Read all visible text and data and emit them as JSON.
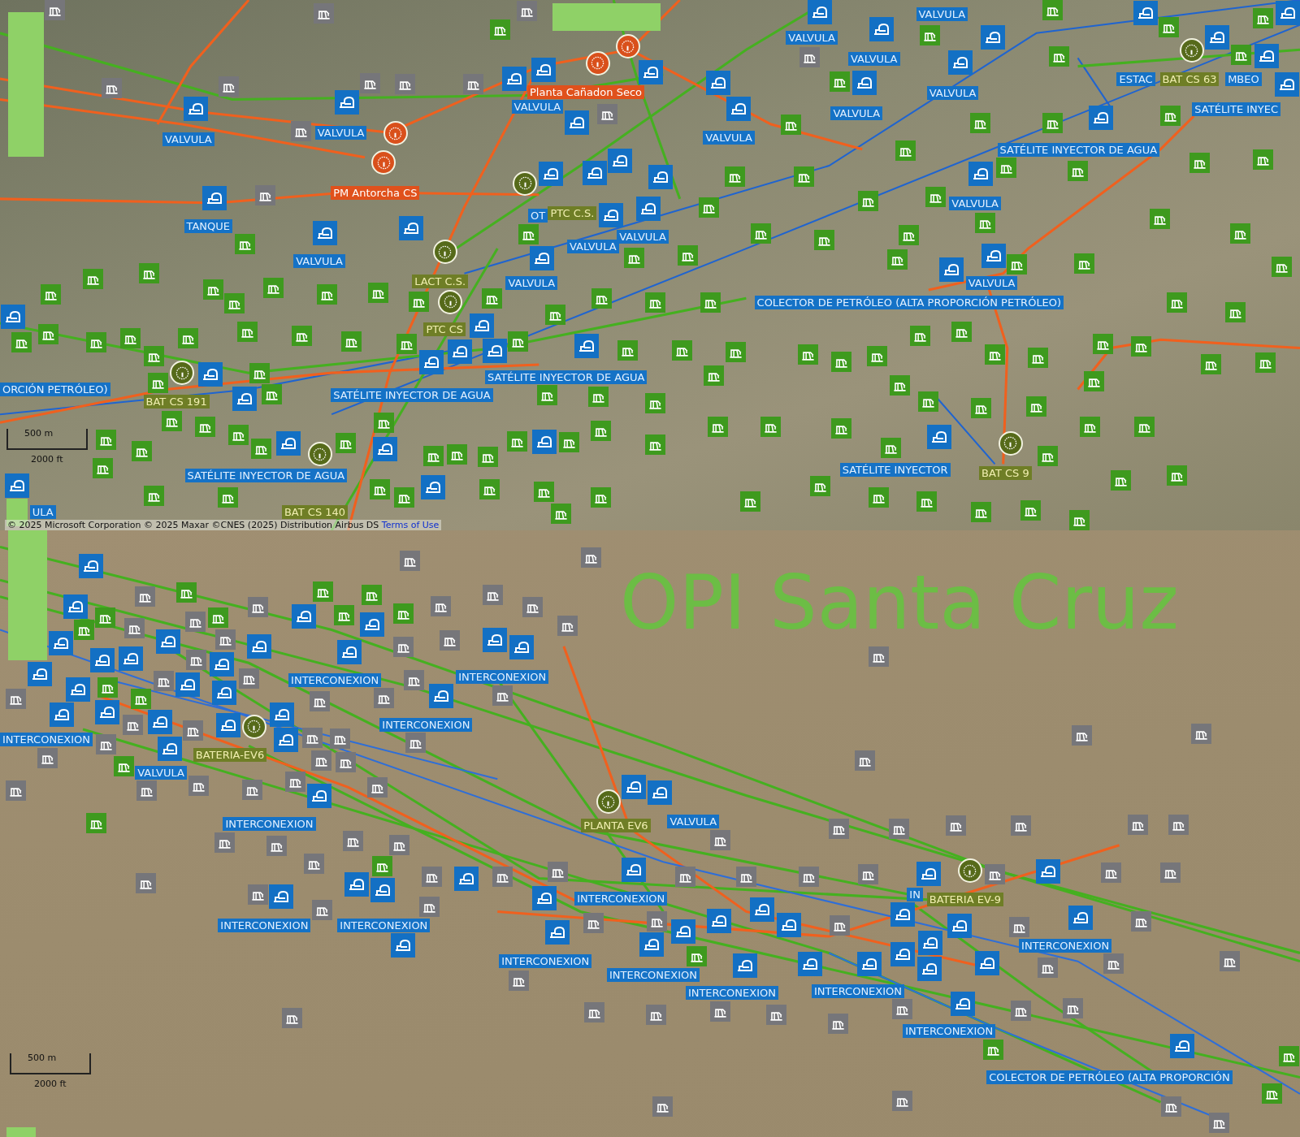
{
  "top_map": {
    "labels": [
      {
        "text": "VALVULA",
        "kind": "asset"
      },
      {
        "text": "VALVULA",
        "kind": "asset"
      },
      {
        "text": "Planta Cañadon Seco",
        "kind": "plant"
      },
      {
        "text": "VALVULA",
        "kind": "asset"
      },
      {
        "text": "PM Antorcha CS",
        "kind": "plant"
      },
      {
        "text": "TANQUE",
        "kind": "asset"
      },
      {
        "text": "VALVULA",
        "kind": "asset"
      },
      {
        "text": "VALVULA",
        "kind": "asset"
      },
      {
        "text": "VALVULA",
        "kind": "asset"
      },
      {
        "text": "OT",
        "kind": "asset"
      },
      {
        "text": "PTC C.S.",
        "kind": "battery"
      },
      {
        "text": "LACT C.S.",
        "kind": "battery"
      },
      {
        "text": "VALVULA",
        "kind": "asset"
      },
      {
        "text": "PTC CS",
        "kind": "battery"
      },
      {
        "text": "VALVULA",
        "kind": "asset"
      },
      {
        "text": "VALVULA",
        "kind": "asset"
      },
      {
        "text": "VALVULA",
        "kind": "asset"
      },
      {
        "text": "VALVULA",
        "kind": "asset"
      },
      {
        "text": "VALVULA",
        "kind": "asset"
      },
      {
        "text": "VALVULA",
        "kind": "asset"
      },
      {
        "text": "VALVULA",
        "kind": "asset"
      },
      {
        "text": "VALVULA",
        "kind": "asset"
      },
      {
        "text": "ESTAC",
        "kind": "asset"
      },
      {
        "text": "BAT CS 63",
        "kind": "battery"
      },
      {
        "text": "MBEO",
        "kind": "asset"
      },
      {
        "text": "SATÉLITE INYEC",
        "kind": "asset"
      },
      {
        "text": "SATÉLITE INYECTOR DE AGUA",
        "kind": "asset"
      },
      {
        "text": "COLECTOR DE PETRÓLEO (ALTA PROPORCIÓN PETRÓLEO)",
        "kind": "asset"
      },
      {
        "text": "ORCIÓN PETRÓLEO)",
        "kind": "asset"
      },
      {
        "text": "BAT CS 191",
        "kind": "battery"
      },
      {
        "text": "SATÉLITE INYECTOR DE AGUA",
        "kind": "asset"
      },
      {
        "text": "SATÉLITE INYECTOR DE AGUA",
        "kind": "asset"
      },
      {
        "text": "SATÉLITE INYECTOR DE AGUA",
        "kind": "asset"
      },
      {
        "text": "SATÉLITE INYECTOR",
        "kind": "asset"
      },
      {
        "text": "BAT CS 9",
        "kind": "battery"
      },
      {
        "text": "ULA",
        "kind": "asset"
      },
      {
        "text": "BAT CS 140",
        "kind": "battery"
      }
    ],
    "scale_bar": {
      "metric": "500 m",
      "imperial": "2000 ft"
    },
    "attribution": {
      "text": "© 2025 Microsoft Corporation © 2025 Maxar ©CNES (2025) Distribution Airbus DS",
      "link": "Terms of Use"
    }
  },
  "bottom_map": {
    "title": "OPI Santa Cruz",
    "labels": [
      {
        "text": "INTERCONEXION",
        "kind": "asset"
      },
      {
        "text": "INTERCONEXION",
        "kind": "asset"
      },
      {
        "text": "INTERCONEXION",
        "kind": "asset"
      },
      {
        "text": "INTERCONEXION",
        "kind": "asset"
      },
      {
        "text": "BATERIA-EV6",
        "kind": "battery"
      },
      {
        "text": "VALVULA",
        "kind": "asset"
      },
      {
        "text": "INTERCONEXION",
        "kind": "asset"
      },
      {
        "text": "PLANTA EV6",
        "kind": "battery"
      },
      {
        "text": "VALVULA",
        "kind": "asset"
      },
      {
        "text": "INTERCONEXION",
        "kind": "asset"
      },
      {
        "text": "INTERCONEXION",
        "kind": "asset"
      },
      {
        "text": "INTERCONEXION",
        "kind": "asset"
      },
      {
        "text": "INTERCONEXION",
        "kind": "asset"
      },
      {
        "text": "INTERCONEXION",
        "kind": "asset"
      },
      {
        "text": "INTERCONEXION",
        "kind": "asset"
      },
      {
        "text": "INTERCONEXION",
        "kind": "asset"
      },
      {
        "text": "IN",
        "kind": "asset"
      },
      {
        "text": "BATERIA EV-9",
        "kind": "battery"
      },
      {
        "text": "INTERCONEXION",
        "kind": "asset"
      },
      {
        "text": "INTERCONEXION",
        "kind": "asset"
      },
      {
        "text": "COLECTOR DE PETRÓLEO (ALTA PROPORCIÓN",
        "kind": "asset"
      }
    ],
    "scale_bar": {
      "metric": "500 m",
      "imperial": "2000 ft"
    }
  }
}
